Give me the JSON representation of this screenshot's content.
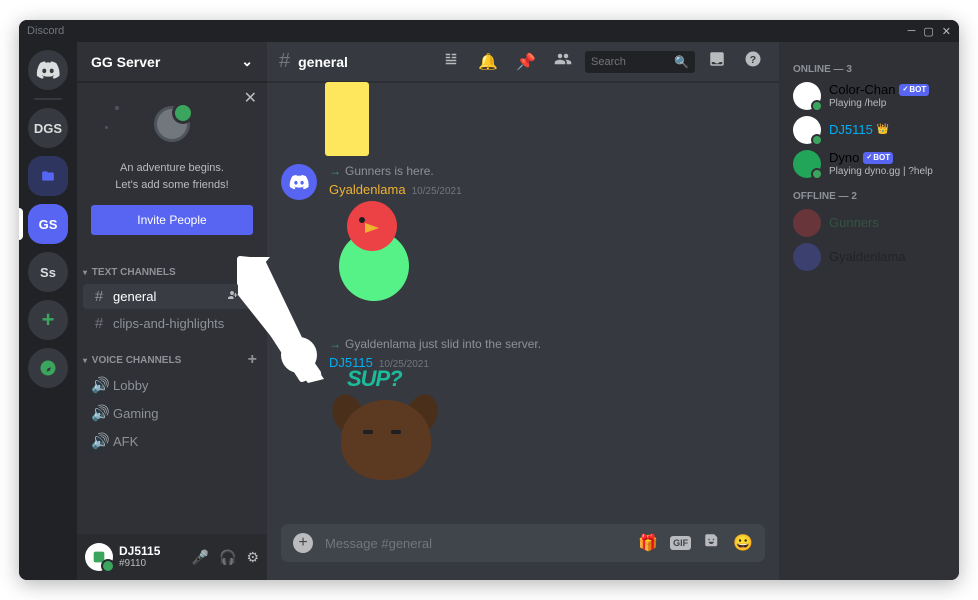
{
  "app_name": "Discord",
  "servers": {
    "home": "home",
    "dgs": "DGS",
    "gs": "GS",
    "ss": "Ss"
  },
  "server": {
    "name": "GG Server",
    "welcome_line1": "An adventure begins.",
    "welcome_line2": "Let's add some friends!",
    "invite_button": "Invite People",
    "text_channels_label": "Text Channels",
    "voice_channels_label": "Voice Channels",
    "channels_text": [
      "general",
      "clips-and-highlights"
    ],
    "channels_voice": [
      "Lobby",
      "Gaming",
      "AFK"
    ]
  },
  "user_panel": {
    "name": "DJ5115",
    "tag": "#9110"
  },
  "header": {
    "channel": "general",
    "search_placeholder": "Search"
  },
  "messages": [
    {
      "system": "Gunners is here.",
      "author": "Gyaldenlama",
      "author_color": "orange",
      "timestamp": "10/25/2021"
    },
    {
      "system": "Gyaldenlama just slid into the server.",
      "author": "DJ5115",
      "author_color": "blue",
      "timestamp": "10/25/2021",
      "sticker_text": "SUP?"
    }
  ],
  "composer": {
    "placeholder": "Message #general"
  },
  "members": {
    "online_header": "Online — 3",
    "offline_header": "Offline — 2",
    "online": [
      {
        "name": "Color-Chan",
        "color": "#dcddde",
        "bot": true,
        "status": "Playing /help"
      },
      {
        "name": "DJ5115",
        "color": "#00aff4",
        "crown": true
      },
      {
        "name": "Dyno",
        "color": "#dcddde",
        "bot": true,
        "status": "Playing dyno.gg | ?help"
      }
    ],
    "offline": [
      {
        "name": "Gunners",
        "color": "#3ba55d"
      },
      {
        "name": "Gyaldenlama",
        "color": "#b9bbbe"
      }
    ]
  },
  "bot_label": "BOT"
}
